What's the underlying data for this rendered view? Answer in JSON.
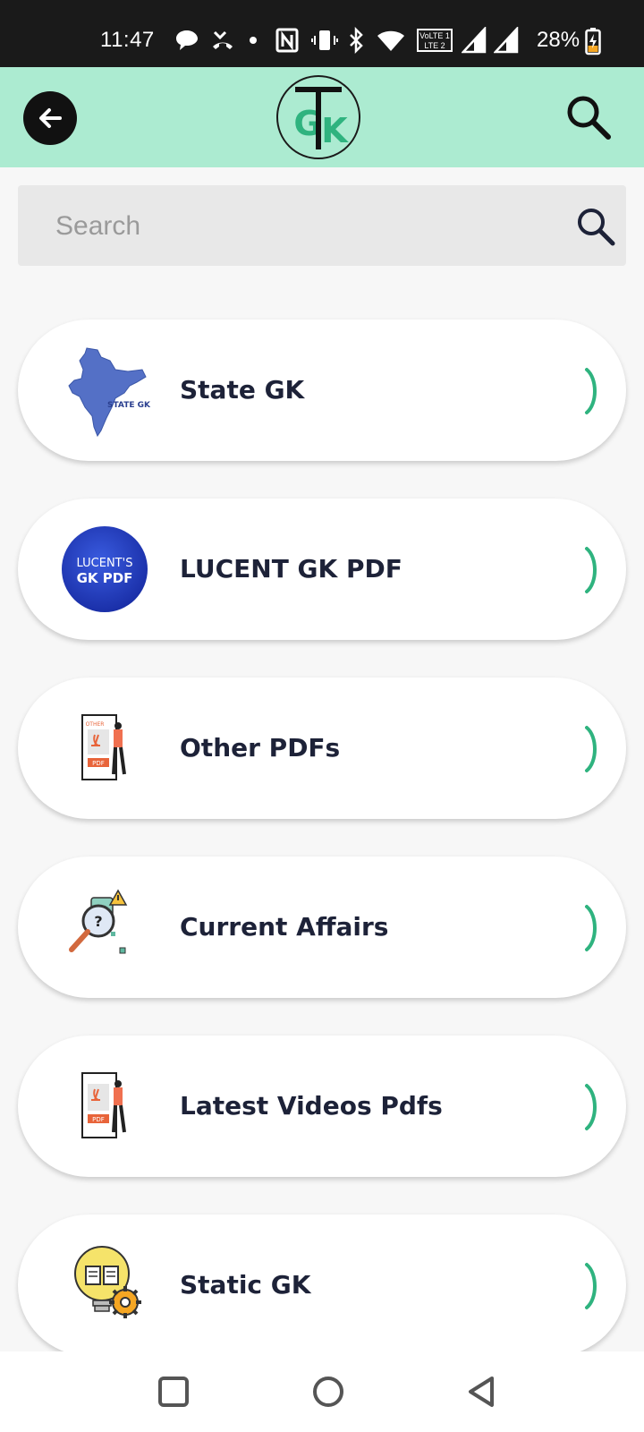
{
  "status_bar": {
    "time": "11:47",
    "battery": "28%",
    "icons": [
      "chat-bubble-icon",
      "missed-call-icon",
      "dot-icon",
      "nfc-icon",
      "vibrate-icon",
      "bluetooth-icon",
      "wifi-icon",
      "volte-icon",
      "signal-icon",
      "signal-icon",
      "battery-charging-icon"
    ],
    "volte_label_1": "VoLTE 1",
    "volte_label_2": "LTE 2"
  },
  "header": {
    "back_icon": "arrow-left-icon",
    "logo_letters": "TGK",
    "search_icon": "search-icon",
    "background": "#acebd1"
  },
  "search": {
    "placeholder": "Search",
    "value": ""
  },
  "categories": [
    {
      "label": "State GK",
      "icon": "india-map-icon",
      "icon_text": "STATE GK"
    },
    {
      "label": "LUCENT GK PDF",
      "icon": "lucent-gk-pdf-badge",
      "icon_text_1": "LUCENT'S",
      "icon_text_2": "GK PDF"
    },
    {
      "label": "Other PDFs",
      "icon": "pdf-document-person-icon",
      "icon_text_1": "OTHER",
      "icon_text_2": "PDF"
    },
    {
      "label": "Current Affairs",
      "icon": "magnifier-question-icon",
      "icon_text": "?"
    },
    {
      "label": "Latest Videos Pdfs",
      "icon": "pdf-document-person-icon",
      "icon_text": "PDF"
    },
    {
      "label": "Static GK",
      "icon": "book-bulb-gear-icon"
    }
  ],
  "colors": {
    "accent_green": "#2fb37f",
    "label_text": "#1d2238",
    "lucent_blue": "#1e3dbd"
  },
  "nav_bar": {
    "recents": "square-icon",
    "home": "circle-icon",
    "back": "triangle-back-icon"
  }
}
